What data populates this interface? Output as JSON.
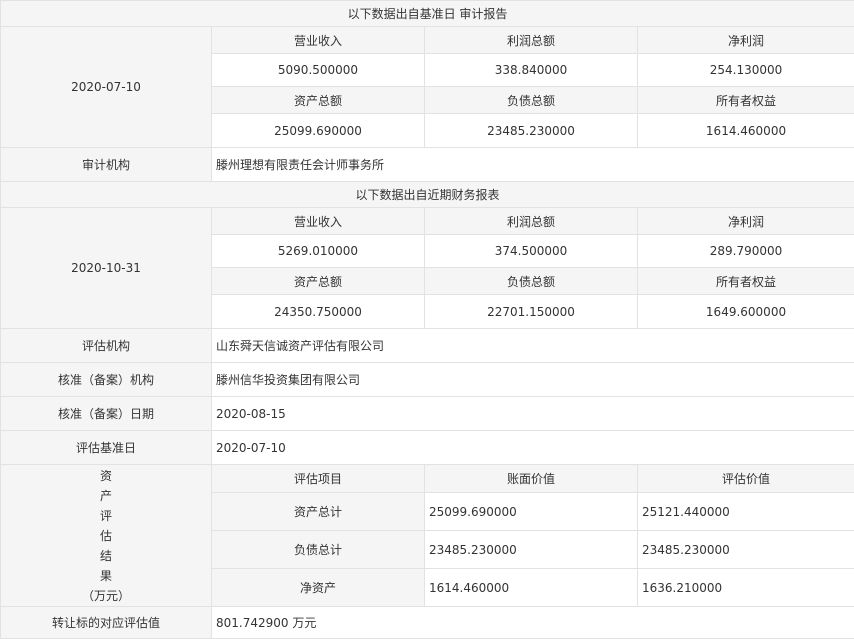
{
  "audit": {
    "section_title": "以下数据出自基准日 审计报告",
    "date": "2020-07-10",
    "headers1": [
      "营业收入",
      "利润总额",
      "净利润"
    ],
    "values1": [
      "5090.500000",
      "338.840000",
      "254.130000"
    ],
    "headers2": [
      "资产总额",
      "负债总额",
      "所有者权益"
    ],
    "values2": [
      "25099.690000",
      "23485.230000",
      "1614.460000"
    ],
    "org_label": "审计机构",
    "org_value": "滕州理想有限责任会计师事务所"
  },
  "recent": {
    "section_title": "以下数据出自近期财务报表",
    "date": "2020-10-31",
    "headers1": [
      "营业收入",
      "利润总额",
      "净利润"
    ],
    "values1": [
      "5269.010000",
      "374.500000",
      "289.790000"
    ],
    "headers2": [
      "资产总额",
      "负债总额",
      "所有者权益"
    ],
    "values2": [
      "24350.750000",
      "22701.150000",
      "1649.600000"
    ]
  },
  "info_rows": [
    {
      "label": "评估机构",
      "value": "山东舜天信诚资产评估有限公司"
    },
    {
      "label": "核准（备案）机构",
      "value": "滕州信华投资集团有限公司"
    },
    {
      "label": "核准（备案）日期",
      "value": "2020-08-15"
    },
    {
      "label": "评估基准日",
      "value": "2020-07-10"
    }
  ],
  "assessment": {
    "label_chars": [
      "资",
      "产",
      "评",
      "估",
      "结",
      "果",
      "（万元）"
    ],
    "headers": [
      "评估项目",
      "账面价值",
      "评估价值"
    ],
    "rows": [
      {
        "item": "资产总计",
        "book": "25099.690000",
        "eval": "25121.440000"
      },
      {
        "item": "负债总计",
        "book": "23485.230000",
        "eval": "23485.230000"
      },
      {
        "item": "净资产",
        "book": "1614.460000",
        "eval": "1636.210000"
      }
    ]
  },
  "transfer": {
    "label": "转让标的对应评估值",
    "value": "801.742900 万元"
  }
}
